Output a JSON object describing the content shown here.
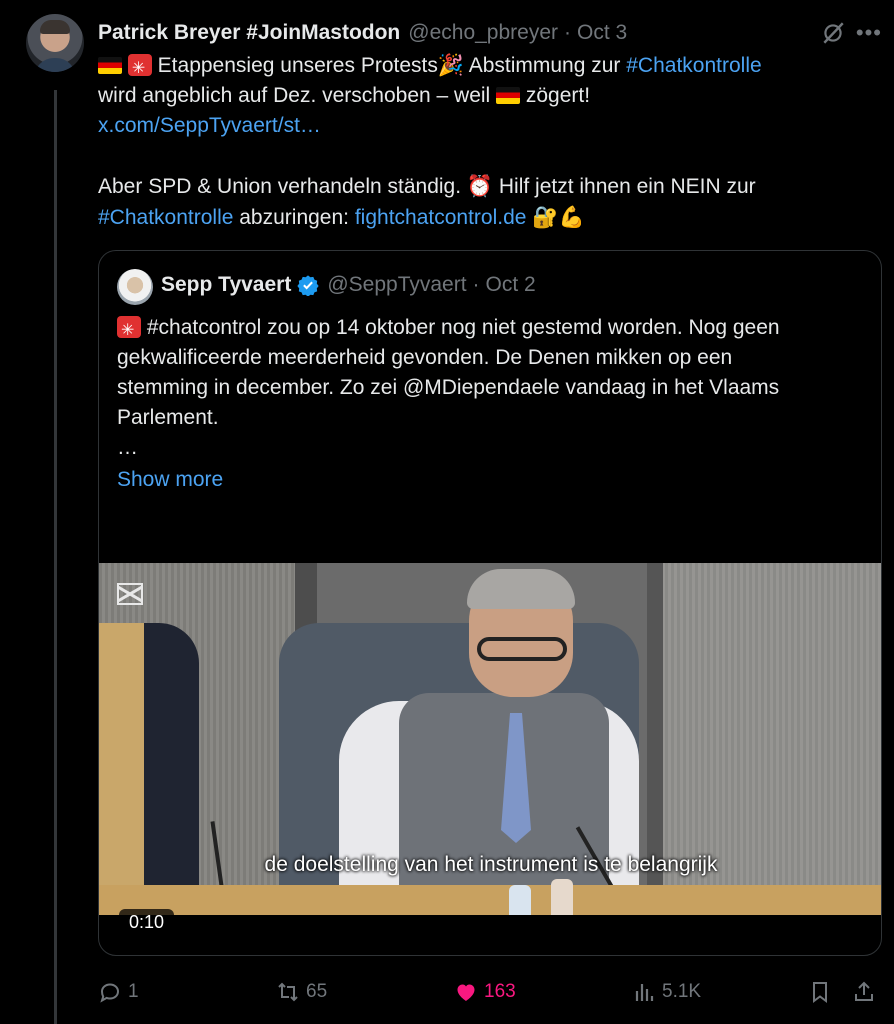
{
  "tweet": {
    "author_name": "Patrick Breyer #JoinMastodon",
    "author_handle": "@echo_pbreyer",
    "separator": "·",
    "date": "Oct 3",
    "line1_text": " Etappensieg unseres Protests",
    "line1_text2": " Abstimmung zur ",
    "hashtag1": "#Chatkontrolle",
    "line2_text": "wird angeblich auf Dez. verschoben – weil ",
    "line2_text2": " zögert!",
    "link1": "x.com/SeppTyvaert/st…",
    "line4_text": "Aber SPD & Union verhandeln ständig. ",
    "line4_text2": " Hilf jetzt ihnen ein NEIN zur",
    "hashtag2": "#Chatkontrolle",
    "line5_text": " abzuringen: ",
    "link2": "fightchatcontrol.de",
    "emoji_party": "🎉",
    "emoji_clock": "⏰",
    "emoji_lock": "🔐",
    "emoji_muscle": "💪"
  },
  "quote": {
    "author_name": "Sepp Tyvaert",
    "author_handle": "@SeppTyvaert",
    "separator": "·",
    "date": "Oct 2",
    "text_line1": " #chatcontrol zou op 14 oktober nog niet gestemd worden. Nog geen",
    "text_line2": "gekwalificeerde meerderheid gevonden. De Denen mikken op een",
    "text_line3": "stemming in december. Zo zei @MDiependaele vandaag in het Vlaams",
    "text_line4": "Parlement.",
    "ellipsis": "…",
    "show_more": "Show more",
    "video_caption": "de doelstelling van het instrument is te belangrijk",
    "video_time": "0:10"
  },
  "actions": {
    "replies": "1",
    "reposts": "65",
    "likes": "163",
    "views": "5.1K"
  },
  "colors": {
    "background": "#000000",
    "text": "#e7e9ea",
    "secondary": "#71767b",
    "link": "#4ca3f2",
    "like": "#f91880",
    "verified": "#1d9bf0"
  },
  "icons": [
    "grok-icon",
    "more-icon",
    "verified-icon",
    "reply-icon",
    "repost-icon",
    "heart-icon",
    "views-icon",
    "bookmark-icon",
    "share-icon",
    "capcut-icon"
  ]
}
